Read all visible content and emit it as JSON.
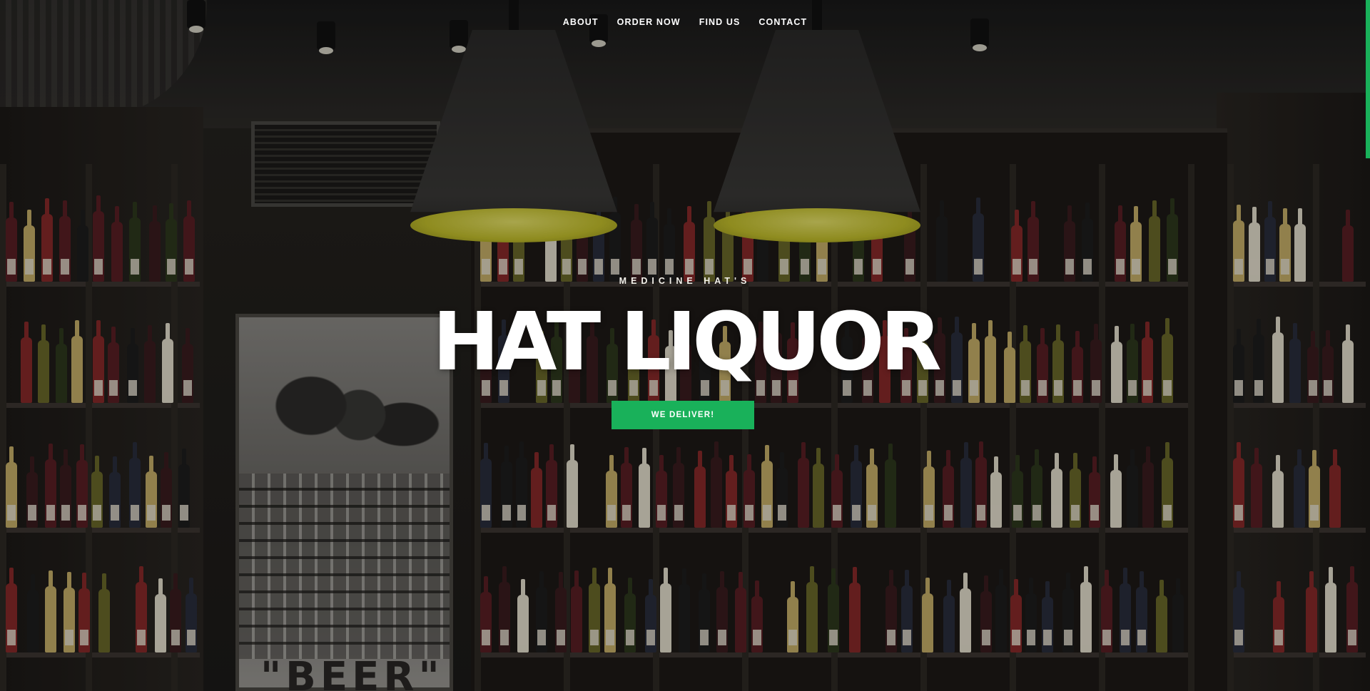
{
  "nav": {
    "items": [
      {
        "label": "ABOUT"
      },
      {
        "label": "ORDER NOW"
      },
      {
        "label": "FIND US"
      },
      {
        "label": "CONTACT"
      }
    ]
  },
  "hero": {
    "kicker": "MEDICINE HAT'S",
    "title": "HAT LIQUOR",
    "cta_label": "WE DELIVER!"
  },
  "poster": {
    "text": "\"BEER\""
  },
  "colors": {
    "accent": "#19b15a",
    "text": "#ffffff",
    "lamp_glow": "#d9d52f"
  }
}
